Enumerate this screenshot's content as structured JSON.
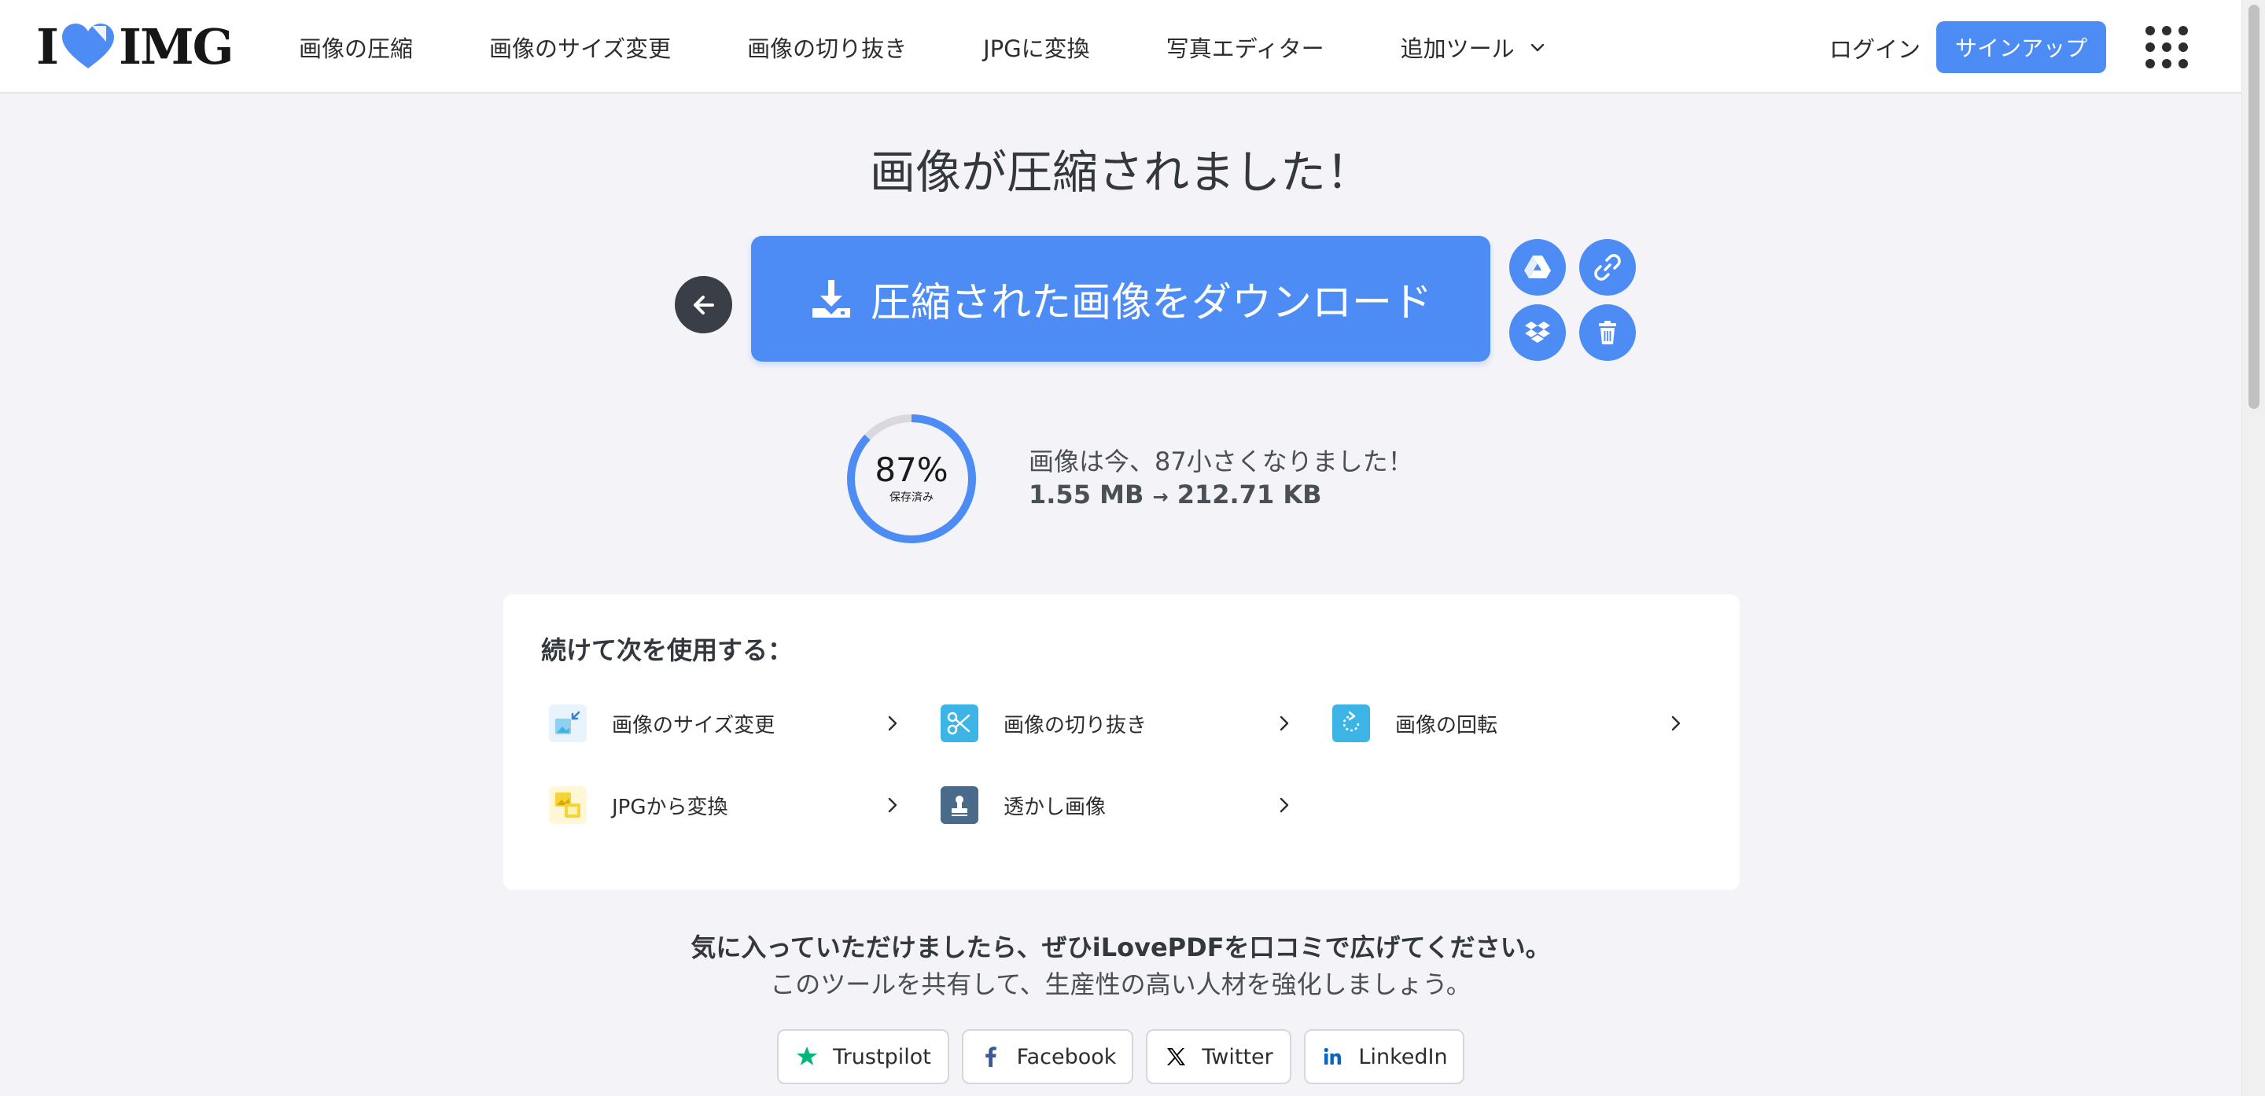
{
  "header": {
    "logo": {
      "left": "I",
      "right": "IMG"
    },
    "nav": [
      {
        "label": "画像の圧縮"
      },
      {
        "label": "画像のサイズ変更"
      },
      {
        "label": "画像の切り抜き"
      },
      {
        "label": "JPGに変換"
      },
      {
        "label": "写真エディター"
      },
      {
        "label": "追加ツール"
      }
    ],
    "login": "ログイン",
    "signup": "サインアップ"
  },
  "main": {
    "title": "画像が圧縮されました！",
    "download_label": "圧縮された画像をダウンロード",
    "side_buttons": [
      "google-drive-icon",
      "link-icon",
      "dropbox-icon",
      "trash-icon"
    ]
  },
  "result": {
    "percent": "87%",
    "percent_sub": "保存済み",
    "saved_fraction": 0.87,
    "message": "画像は今、87小さくなりました！",
    "size_before": "1.55 MB",
    "arrow": "→",
    "size_after": "212.71 KB"
  },
  "continue": {
    "title": "続けて次を使用する：",
    "tools": [
      {
        "label": "画像のサイズ変更",
        "icon": "resize-icon",
        "color": "#e8f3fb"
      },
      {
        "label": "画像の切り抜き",
        "icon": "scissors-icon",
        "color": "#3db4e6"
      },
      {
        "label": "画像の回転",
        "icon": "rotate-icon",
        "color": "#3db4e6"
      },
      {
        "label": "JPGから変換",
        "icon": "convert-from-jpg-icon",
        "color": "#f7d33a"
      },
      {
        "label": "透かし画像",
        "icon": "watermark-icon",
        "color": "#4a6a8a"
      }
    ]
  },
  "share": {
    "line1": "気に入っていただけましたら、ぜひiLovePDFを口コミで広げてください。",
    "line2": "このツールを共有して、生産性の高い人材を強化しましょう。",
    "buttons": [
      {
        "label": "Trustpilot",
        "icon": "trustpilot-star-icon",
        "color": "#00b67a"
      },
      {
        "label": "Facebook",
        "icon": "facebook-icon",
        "color": "#3b5998"
      },
      {
        "label": "Twitter",
        "icon": "x-twitter-icon",
        "color": "#000000"
      },
      {
        "label": "LinkedIn",
        "icon": "linkedin-icon",
        "color": "#0a66c2"
      }
    ]
  },
  "colors": {
    "accent": "#4d8cf5",
    "back_button": "#3a3f47",
    "background": "#f4f4f8"
  }
}
